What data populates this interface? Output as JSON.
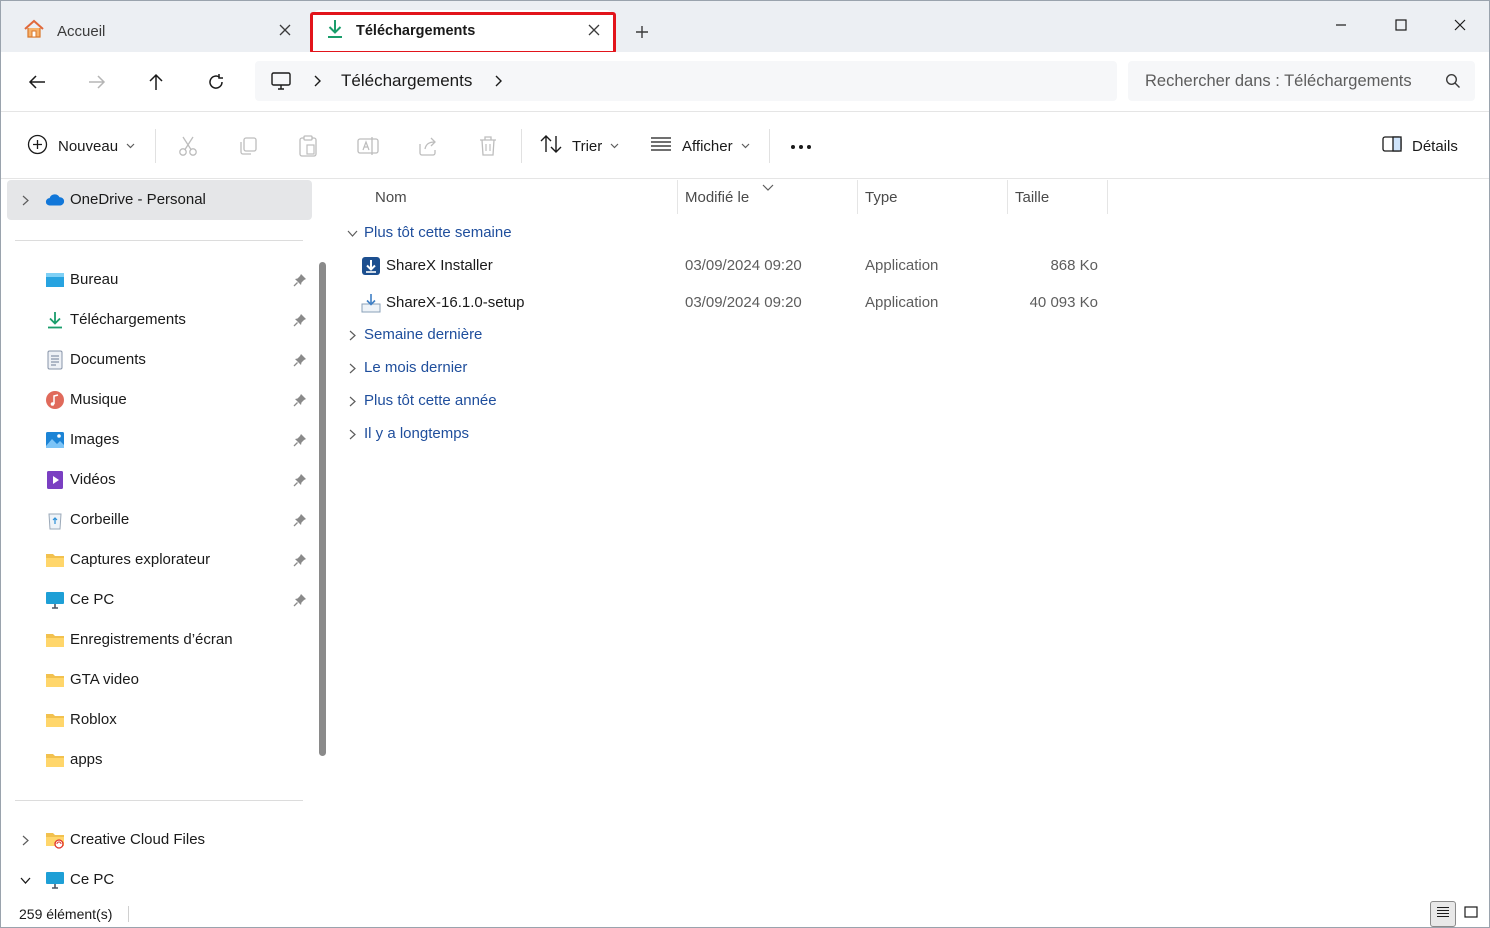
{
  "tabs": [
    {
      "label": "Accueil",
      "icon": "home-icon",
      "active": false
    },
    {
      "label": "Téléchargements",
      "icon": "download-icon",
      "active": true
    }
  ],
  "address": {
    "root_icon": "computer-icon",
    "crumbs": [
      "Téléchargements"
    ]
  },
  "search": {
    "placeholder": "Rechercher dans : Téléchargements"
  },
  "commands": {
    "new_label": "Nouveau",
    "sort_label": "Trier",
    "view_label": "Afficher",
    "more_label": "•••",
    "details_label": "Détails"
  },
  "sidebar": {
    "onedrive": "OneDrive - Personal",
    "quick_access": [
      {
        "label": "Bureau",
        "icon": "desktop-icon",
        "pinned": true
      },
      {
        "label": "Téléchargements",
        "icon": "download-icon",
        "pinned": true
      },
      {
        "label": "Documents",
        "icon": "documents-icon",
        "pinned": true
      },
      {
        "label": "Musique",
        "icon": "music-icon",
        "pinned": true
      },
      {
        "label": "Images",
        "icon": "images-icon",
        "pinned": true
      },
      {
        "label": "Vidéos",
        "icon": "videos-icon",
        "pinned": true
      },
      {
        "label": "Corbeille",
        "icon": "recycle-bin-icon",
        "pinned": true
      },
      {
        "label": "Captures explorateur",
        "icon": "folder-icon",
        "pinned": true
      },
      {
        "label": "Ce PC",
        "icon": "computer-icon",
        "pinned": true
      },
      {
        "label": "Enregistrements d’écran",
        "icon": "folder-icon",
        "pinned": false
      },
      {
        "label": "GTA video",
        "icon": "folder-icon",
        "pinned": false
      },
      {
        "label": "Roblox",
        "icon": "folder-icon",
        "pinned": false
      },
      {
        "label": "apps",
        "icon": "folder-icon",
        "pinned": false
      }
    ],
    "bottom": [
      {
        "label": "Creative Cloud Files",
        "icon": "creative-cloud-folder-icon",
        "expanded": false
      },
      {
        "label": "Ce PC",
        "icon": "computer-icon",
        "expanded": true
      }
    ]
  },
  "columns": {
    "name": "Nom",
    "modified": "Modifié le",
    "type": "Type",
    "size": "Taille"
  },
  "groups": [
    {
      "label": "Plus tôt cette semaine",
      "expanded": true,
      "files": [
        {
          "name": "ShareX Installer",
          "modified": "03/09/2024 09:20",
          "type": "Application",
          "size": "868 Ko",
          "icon": "installer-icon"
        },
        {
          "name": "ShareX-16.1.0-setup",
          "modified": "03/09/2024 09:20",
          "type": "Application",
          "size": "40 093 Ko",
          "icon": "setup-icon"
        }
      ]
    },
    {
      "label": "Semaine dernière",
      "expanded": false,
      "files": []
    },
    {
      "label": "Le mois dernier",
      "expanded": false,
      "files": []
    },
    {
      "label": "Plus tôt cette année",
      "expanded": false,
      "files": []
    },
    {
      "label": "Il y a longtemps",
      "expanded": false,
      "files": []
    }
  ],
  "status": {
    "count": "259 élément(s)"
  },
  "colors": {
    "accent_download": "#1a9d6b",
    "group_link": "#1f4e9c",
    "highlight_box": "#e2141b",
    "folder": "#f2c14e"
  }
}
